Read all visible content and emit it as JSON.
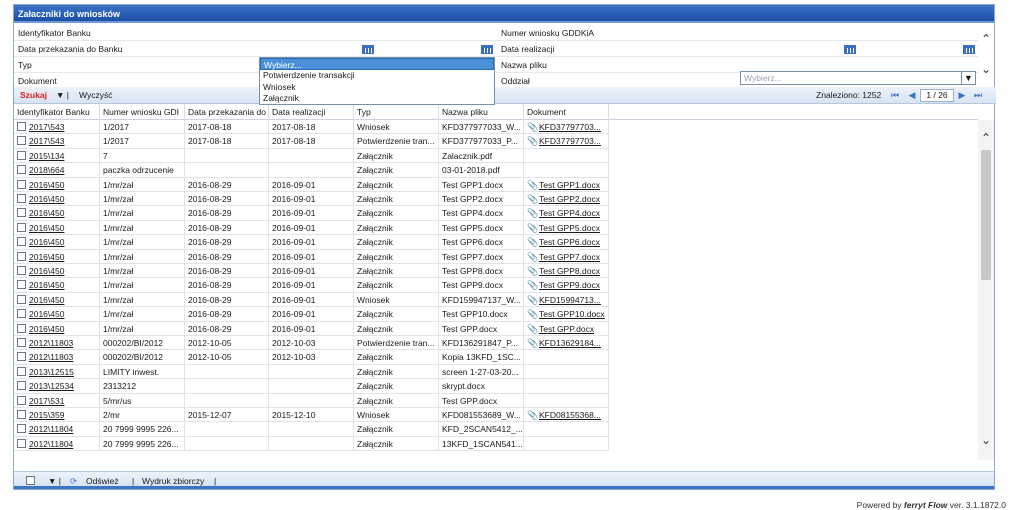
{
  "window": {
    "title": "Załaczniki do wniosków"
  },
  "filters": {
    "identyfikator_label": "Identyfikator Banku",
    "numer_label": "Numer wniosku GDDKiA",
    "data_przek_label": "Data przekazania do Banku",
    "data_real_label": "Data realizacji",
    "typ_label": "Typ",
    "nazwa_label": "Nazwa pliku",
    "dokument_label": "Dokument",
    "oddzial_label": "Oddział",
    "oddzial_placeholder": "Wybierz...",
    "typ_dropdown": {
      "selected": "Wybierz...",
      "options": [
        "Potwierdzenie transakcji",
        "Wniosek",
        "Załącznik"
      ]
    }
  },
  "toolbar": {
    "search": "Szukaj",
    "clear": "Wyczyść",
    "found": "Znaleziono: 1252",
    "page": "1 / 26"
  },
  "grid": {
    "columns": [
      "Identyfikator Banku",
      "Numer wniosku GDI",
      "Data przekazania do",
      "Data realizacji",
      "Typ",
      "Nazwa pliku",
      "Dokument"
    ],
    "rows": [
      [
        "2017\\543",
        "1/2017",
        "2017-08-18",
        "2017-08-18",
        "Wniosek",
        "KFD377977033_W...",
        "KFD37797703..."
      ],
      [
        "2017\\543",
        "1/2017",
        "2017-08-18",
        "2017-08-18",
        "Potwierdzenie tran...",
        "KFD377977033_P...",
        "KFD37797703..."
      ],
      [
        "2015\\134",
        "7",
        "",
        "",
        "Załącznik",
        "Zalacznik.pdf",
        ""
      ],
      [
        "2018\\664",
        "paczka odrzucenie",
        "",
        "",
        "Załącznik",
        "03-01-2018.pdf",
        ""
      ],
      [
        "2016\\450",
        "1/mr/zał",
        "2016-08-29",
        "2016-09-01",
        "Załącznik",
        "Test GPP1.docx",
        "Test GPP1.docx"
      ],
      [
        "2016\\450",
        "1/mr/zał",
        "2016-08-29",
        "2016-09-01",
        "Załącznik",
        "Test GPP2.docx",
        "Test GPP2.docx"
      ],
      [
        "2016\\450",
        "1/mr/zał",
        "2016-08-29",
        "2016-09-01",
        "Załącznik",
        "Test GPP4.docx",
        "Test GPP4.docx"
      ],
      [
        "2016\\450",
        "1/mr/zał",
        "2016-08-29",
        "2016-09-01",
        "Załącznik",
        "Test GPP5.docx",
        "Test GPP5.docx"
      ],
      [
        "2016\\450",
        "1/mr/zał",
        "2016-08-29",
        "2016-09-01",
        "Załącznik",
        "Test GPP6.docx",
        "Test GPP6.docx"
      ],
      [
        "2016\\450",
        "1/mr/zał",
        "2016-08-29",
        "2016-09-01",
        "Załącznik",
        "Test GPP7.docx",
        "Test GPP7.docx"
      ],
      [
        "2016\\450",
        "1/mr/zał",
        "2016-08-29",
        "2016-09-01",
        "Załącznik",
        "Test GPP8.docx",
        "Test GPP8.docx"
      ],
      [
        "2016\\450",
        "1/mr/zał",
        "2016-08-29",
        "2016-09-01",
        "Załącznik",
        "Test GPP9.docx",
        "Test GPP9.docx"
      ],
      [
        "2016\\450",
        "1/mr/zał",
        "2016-08-29",
        "2016-09-01",
        "Wniosek",
        "KFD159947137_W...",
        "KFD15994713..."
      ],
      [
        "2016\\450",
        "1/mr/zał",
        "2016-08-29",
        "2016-09-01",
        "Załącznik",
        "Test GPP10.docx",
        "Test GPP10.docx"
      ],
      [
        "2016\\450",
        "1/mr/zał",
        "2016-08-29",
        "2016-09-01",
        "Załącznik",
        "Test GPP.docx",
        "Test GPP.docx"
      ],
      [
        "2012\\11803",
        "000202/BI/2012",
        "2012-10-05",
        "2012-10-03",
        "Potwierdzenie tran...",
        "KFD136291847_P...",
        "KFD13629184..."
      ],
      [
        "2012\\11803",
        "000202/BI/2012",
        "2012-10-05",
        "2012-10-03",
        "Załącznik",
        "Kopia 13KFD_1SC...",
        ""
      ],
      [
        "2013\\12515",
        "LIMITY inwest.",
        "",
        "",
        "Załącznik",
        "screen 1-27-03-20...",
        ""
      ],
      [
        "2013\\12534",
        "2313212",
        "",
        "",
        "Załącznik",
        "skrypt.docx",
        ""
      ],
      [
        "2017\\531",
        "5/mr/us",
        "",
        "",
        "Załącznik",
        "Test GPP.docx",
        ""
      ],
      [
        "2015\\359",
        "2/mr",
        "2015-12-07",
        "2015-12-10",
        "Wniosek",
        "KFD081553689_W...",
        "KFD08155368..."
      ],
      [
        "2012\\11804",
        "20 7999 9995 226...",
        "",
        "",
        "Załącznik",
        "KFD_2SCAN5412_...",
        ""
      ],
      [
        "2012\\11804",
        "20 7999 9995 226...",
        "",
        "",
        "Załącznik",
        "13KFD_1SCAN541...",
        ""
      ]
    ]
  },
  "footer": {
    "refresh": "Odśwież",
    "print": "Wydruk zbiorczy"
  },
  "powered": {
    "prefix": "Powered by",
    "brand": "ferryt Flow",
    "version": "ver. 3.1.1872.0"
  },
  "icons": [
    "calendar-icon",
    "paperclip-icon",
    "refresh-icon",
    "chevron-down-icon",
    "chevron-up-icon"
  ],
  "colors": {
    "title_bar": "#1d4fa5",
    "search": "#dd2222",
    "selection": "#4a90d9"
  }
}
